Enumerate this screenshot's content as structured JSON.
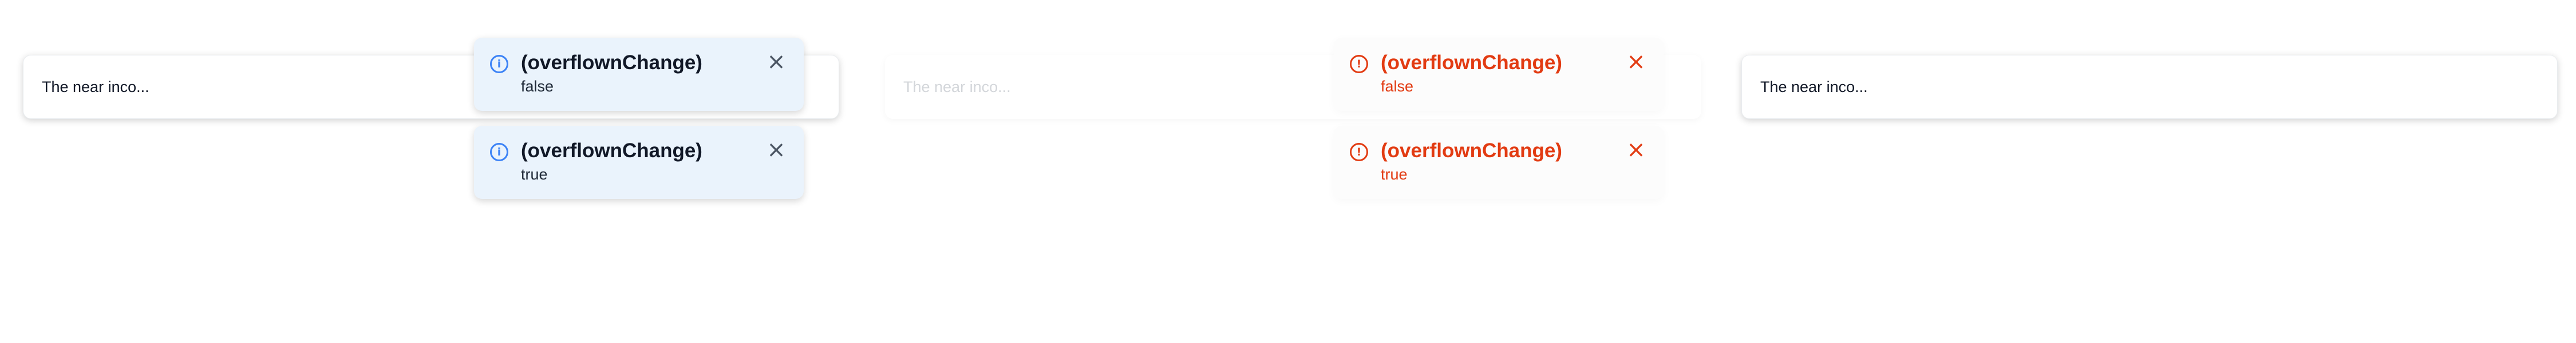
{
  "cards": [
    {
      "text": "The near inco..."
    },
    {
      "text": "The near inco..."
    },
    {
      "text": "The near inco..."
    }
  ],
  "info_toasts": [
    {
      "title": "(overflownChange)",
      "message": "false",
      "icon": "info-icon",
      "close": "close-icon"
    },
    {
      "title": "(overflownChange)",
      "message": "true",
      "icon": "info-icon",
      "close": "close-icon"
    }
  ],
  "error_toasts": [
    {
      "title": "(overflownChange)",
      "message": "false",
      "icon": "error-icon",
      "close": "close-icon"
    },
    {
      "title": "(overflownChange)",
      "message": "true",
      "icon": "error-icon",
      "close": "close-icon"
    }
  ],
  "colors": {
    "info_accent": "#3b82f6",
    "info_background": "#eaf3fc",
    "error_accent": "#e23b12",
    "card_text": "#111827"
  }
}
